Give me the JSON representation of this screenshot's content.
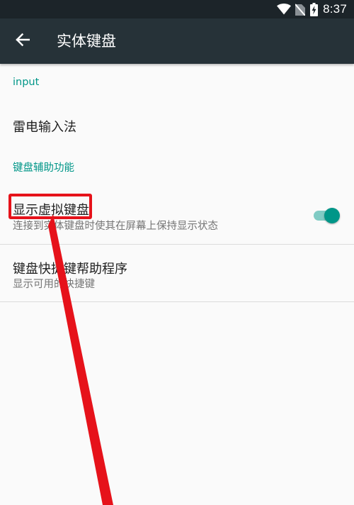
{
  "status_bar": {
    "time": "8:37",
    "icons": [
      "wifi-icon",
      "no-sim-icon",
      "battery-charging-icon"
    ]
  },
  "app_bar": {
    "back_icon": "arrow-back-icon",
    "title": "实体键盘"
  },
  "sections": [
    {
      "header": "input",
      "items": [
        {
          "title": "雷电输入法"
        }
      ]
    },
    {
      "header": "键盘辅助功能",
      "items": [
        {
          "title": "显示虚拟键盘",
          "summary": "连接到实体键盘时使其在屏幕上保持显示状态",
          "switch_on": true
        },
        {
          "title": "键盘快捷键帮助程序",
          "summary": "显示可用的快捷键"
        }
      ]
    }
  ],
  "colors": {
    "accent": "#009688",
    "toolbar": "#263238",
    "status_bar": "#1c2429",
    "annotation": "#e6121a"
  }
}
